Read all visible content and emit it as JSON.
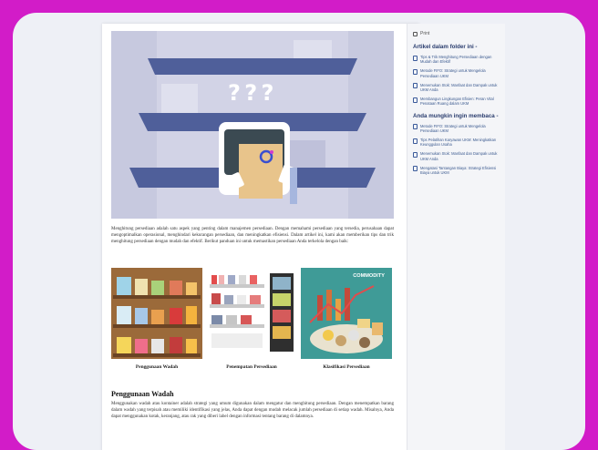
{
  "sidebar": {
    "print_label": "Print",
    "folder_heading": "Artikel dalam folder ini -",
    "folder_items": [
      {
        "label": "Tips & Trik Menghitung Persediaan dengan Mudah dan Efektif"
      },
      {
        "label": "Metode FIFO: Strategi untuk Mengelola Persediaan UKM"
      },
      {
        "label": "Menemukan Stok: Manfaat dan Dampak untuk UKM Anda"
      },
      {
        "label": "Membangun Lingkungan Efisien: Peran Vital Penataan Ruang dalam UKM"
      }
    ],
    "related_heading": "Anda mungkin ingin membaca -",
    "related_items": [
      {
        "label": "Metode FIFO: Strategi untuk Mengelola Persediaan UKM"
      },
      {
        "label": "Tips Pelatihan Karyawan UKM: Meningkatkan Keunggulan Usaha"
      },
      {
        "label": "Menemukan Stok: Manfaat dan Dampak untuk UKM Anda"
      },
      {
        "label": "Mengatasi Tantangan Biaya: Strategi Efisiensi Biaya untuk UKM"
      }
    ]
  },
  "article": {
    "hero_marks": "? ? ?",
    "intro": "Menghitung persediaan adalah satu aspek yang penting dalam manajemen persediaan. Dengan memahami persediaan yang tersedia, perusahaan dapat mengoptimalkan operasional, menghindari kekurangan persediaan, dan meningkatkan efisiensi. Dalam artikel ini, kami akan memberikan tips dan trik menghitung persediaan dengan mudah dan efektif. Berikut panduan ini untuk memastikan persediaan Anda terkelola dengan baik:",
    "gallery": [
      {
        "caption": "Penggunaan Wadah"
      },
      {
        "caption": "Penempatan Persediaan"
      },
      {
        "caption": "Klasifikasi Persediaan",
        "badge": "COMMODITY"
      }
    ],
    "section_title": "Penggunaan Wadah",
    "section_body": "Menggunakan wadah atau kontainer adalah strategi yang umum digunakan dalam mengatur dan menghitung persediaan. Dengan menempatkan barang dalam wadah yang terpisah atau memiliki identifikasi yang jelas, Anda dapat dengan mudah melacak jumlah persediaan di setiap wadah. Misalnya, Anda dapat menggunakan kotak, keranjang, atau rak yang diberi label dengan informasi tentang barang di dalamnya."
  },
  "colors": {
    "background": "#d21cc8",
    "link": "#3b5a8f",
    "heading": "#2a3d6e"
  }
}
